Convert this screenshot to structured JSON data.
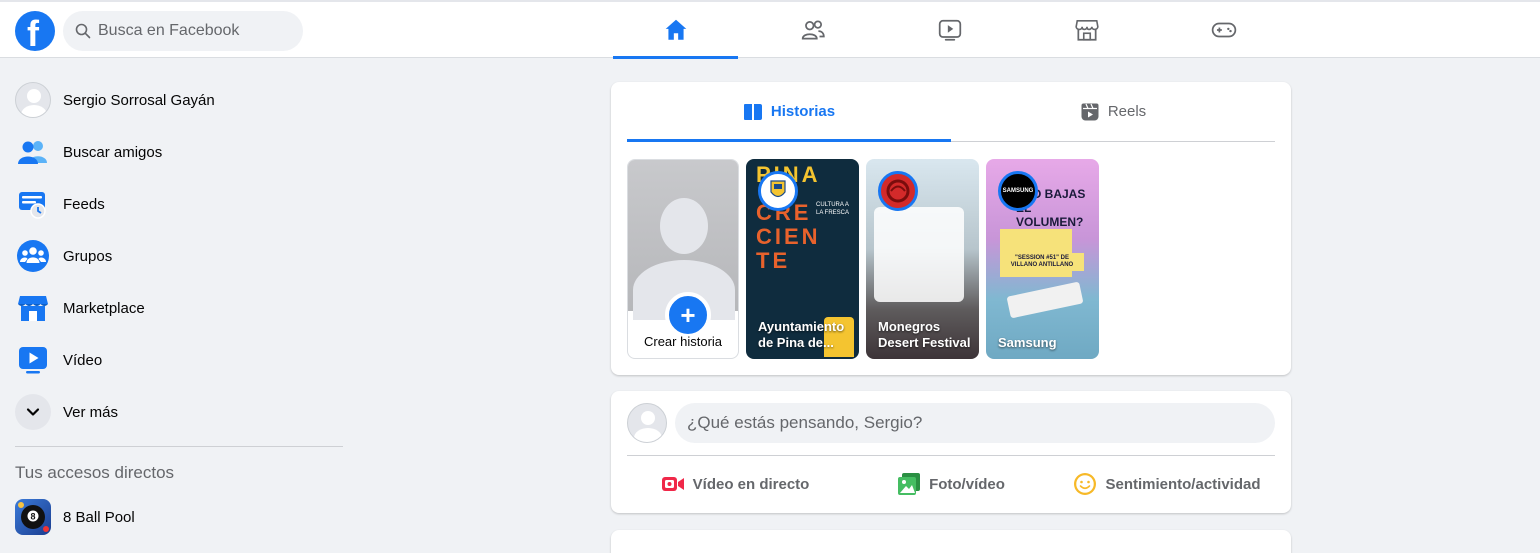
{
  "search": {
    "placeholder": "Busca en Facebook"
  },
  "nav": {
    "tabs": [
      {
        "icon": "home-icon",
        "active": true
      },
      {
        "icon": "friends-icon",
        "active": false
      },
      {
        "icon": "watch-icon",
        "active": false
      },
      {
        "icon": "marketplace-icon",
        "active": false
      },
      {
        "icon": "gaming-icon",
        "active": false
      }
    ]
  },
  "sidebar": {
    "items": [
      {
        "label": "Sergio Sorrosal Gayán",
        "icon": "avatar"
      },
      {
        "label": "Buscar amigos",
        "icon": "friends-icon"
      },
      {
        "label": "Feeds",
        "icon": "feeds-icon"
      },
      {
        "label": "Grupos",
        "icon": "groups-icon"
      },
      {
        "label": "Marketplace",
        "icon": "marketplace-icon"
      },
      {
        "label": "Vídeo",
        "icon": "video-icon"
      },
      {
        "label": "Ver más",
        "icon": "chevron-down-icon"
      }
    ],
    "shortcuts_title": "Tus accesos directos",
    "shortcuts": [
      {
        "label": "8 Ball Pool",
        "icon": "8-ball-pool-icon"
      }
    ]
  },
  "stories": {
    "tabs": [
      {
        "label": "Historias",
        "icon": "stories-icon",
        "active": true
      },
      {
        "label": "Reels",
        "icon": "reels-icon",
        "active": false
      }
    ],
    "create_label": "Crear historia",
    "items": [
      {
        "name": "Ayuntamiento de Pina de...",
        "poster_lines": [
          "PINA",
          "CRE",
          "CIEN",
          "TE"
        ],
        "poster_sub": "CULTURA A LA FRESCA"
      },
      {
        "name": "Monegros Desert Festival"
      },
      {
        "name": "Samsung",
        "poster_lines": [
          "¿NO BAJAS",
          "EL VOLUMEN?"
        ],
        "badge": "\"SESSION #51\" DE VILLANO ANTILLANO",
        "avatar_text": "SAMSUNG"
      }
    ]
  },
  "composer": {
    "placeholder": "¿Qué estás pensando, Sergio?",
    "actions": [
      {
        "label": "Vídeo en directo",
        "icon": "live-video-icon",
        "color": "#f02849"
      },
      {
        "label": "Foto/vídeo",
        "icon": "photo-icon",
        "color": "#45bd62"
      },
      {
        "label": "Sentimiento/actividad",
        "icon": "feeling-icon",
        "color": "#f7b928"
      }
    ]
  },
  "colors": {
    "brand": "#1877f2",
    "background": "#f0f2f5",
    "secondary_text": "#65676b"
  }
}
